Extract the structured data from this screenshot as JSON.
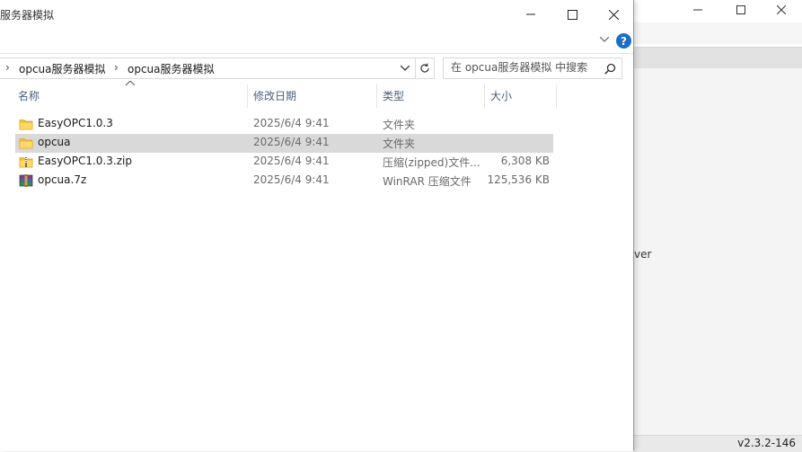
{
  "explorer": {
    "title": "服务器模拟",
    "controls": {
      "minimize_icon": "minimize-icon",
      "maximize_icon": "maximize-icon",
      "close_icon": "close-icon"
    },
    "ribbon": {
      "expand_icon": "chevron-down-icon",
      "help_label": "?"
    },
    "address": {
      "breadcrumbs": [
        "opcua服务器模拟",
        "opcua服务器模拟"
      ],
      "separator": "›"
    },
    "search": {
      "placeholder": "在 opcua服务器模拟 中搜索"
    },
    "columns": {
      "name": "名称",
      "modified": "修改日期",
      "type": "类型",
      "size": "大小"
    },
    "files": [
      {
        "name": "EasyOPC1.0.3",
        "modified": "2025/6/4 9:41",
        "type": "文件夹",
        "size": "",
        "icon": "folder-icon",
        "selected": false
      },
      {
        "name": "opcua",
        "modified": "2025/6/4 9:41",
        "type": "文件夹",
        "size": "",
        "icon": "folder-icon",
        "selected": true
      },
      {
        "name": "EasyOPC1.0.3.zip",
        "modified": "2025/6/4 9:41",
        "type": "压缩(zipped)文件...",
        "size": "6,308 KB",
        "icon": "zip-folder-icon",
        "selected": false
      },
      {
        "name": "opcua.7z",
        "modified": "2025/6/4 9:41",
        "type": "WinRAR 压缩文件",
        "size": "125,536 KB",
        "icon": "winrar-archive-icon",
        "selected": false
      }
    ]
  },
  "background_window": {
    "partial_text": "ver",
    "version": "v2.3.2-146"
  },
  "colors": {
    "selection": "#d9d9d9",
    "header_text": "#4c607a",
    "help_blue": "#1a6dc9",
    "folder_yellow": "#f4c542"
  }
}
